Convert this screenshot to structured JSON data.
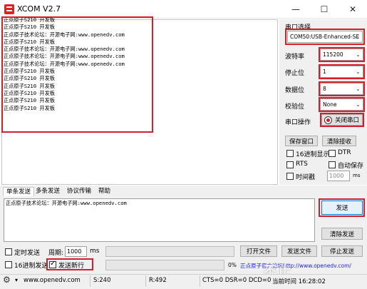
{
  "window": {
    "title": "XCOM V2.7",
    "minimize_glyph": "—",
    "maximize_glyph": "☐",
    "close_glyph": "✕"
  },
  "receive": {
    "lines": [
      "正点原子S210 开发板",
      "正点原子S210 开发板",
      "正点原子技术论坛：开源电子网:www.openedv.com",
      "正点原子S210 开发板",
      "正点原子技术论坛：开源电子网:www.openedv.com",
      "正点原子技术论坛：开源电子网:www.openedv.com",
      "正点原子技术论坛：开源电子网:www.openedv.com",
      "正点原子S210 开发板",
      "正点原子S210 开发板",
      "正点原子S210 开发板",
      "正点原子S210 开发板",
      "正点原子S210 开发板",
      "正点原子S210 开发板"
    ]
  },
  "serial": {
    "port_label": "串口选择",
    "port_value": "COM50:USB-Enhanced-SE",
    "baud_label": "波特率",
    "baud_value": "115200",
    "stop_label": "停止位",
    "stop_value": "1",
    "data_label": "数据位",
    "data_value": "8",
    "parity_label": "校验位",
    "parity_value": "None",
    "op_label": "串口操作",
    "op_button": "关闭串口",
    "save_window": "保存窗口",
    "clear_receive": "清除接收",
    "hex_display": "16进制显示",
    "dtr": "DTR",
    "rts": "RTS",
    "auto_save": "自动保存",
    "timestamp": "时间戳",
    "timestamp_ms_value": "1000",
    "ms_unit": "ms"
  },
  "tabs": [
    "单条发送",
    "多条发送",
    "协议传输",
    "帮助"
  ],
  "send": {
    "text": "正点原子技术论坛：开源电子网:www.openedv.com",
    "send_button": "发送",
    "clear_send": "清除发送",
    "timed_send": "定时发送",
    "period_label": "周期:",
    "period_value": "1000",
    "ms_unit": "ms",
    "open_file": "打开文件",
    "send_file": "发送文件",
    "stop_send": "停止发送",
    "hex_send": "16进制发送",
    "send_newline": "发送新行",
    "progress_text": "0%",
    "progress": 0,
    "forum_link": "正点原子官方论坛http://www.openedv.com/"
  },
  "status": {
    "url": "www.openedv.com",
    "sent": "S:240",
    "received": "R:492",
    "signals": "CTS=0 DSR=0 DCD=0",
    "time": "当前时间 16:28:02"
  },
  "watermark": "不止"
}
